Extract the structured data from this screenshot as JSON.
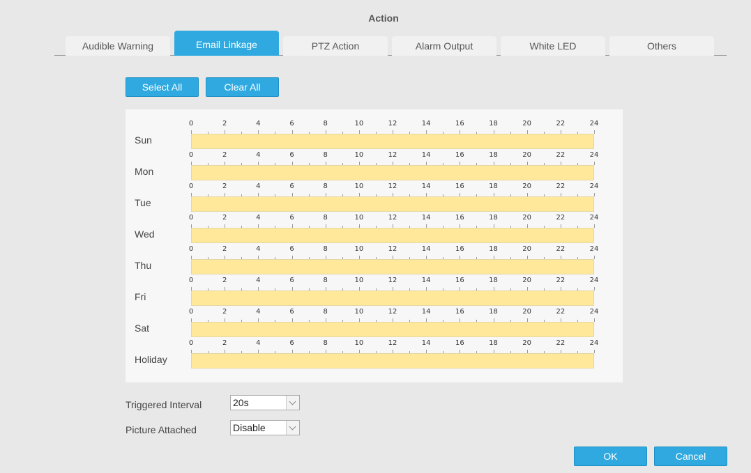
{
  "header": {
    "title": "Action"
  },
  "tabs": [
    {
      "label": "Audible Warning",
      "active": false
    },
    {
      "label": "Email Linkage",
      "active": true
    },
    {
      "label": "PTZ Action",
      "active": false
    },
    {
      "label": "Alarm Output",
      "active": false
    },
    {
      "label": "White LED",
      "active": false
    },
    {
      "label": "Others",
      "active": false
    }
  ],
  "toolbar": {
    "select_all": "Select All",
    "clear_all": "Clear All"
  },
  "schedule": {
    "days": [
      "Sun",
      "Mon",
      "Tue",
      "Wed",
      "Thu",
      "Fri",
      "Sat",
      "Holiday"
    ],
    "hour_labels": [
      "0",
      "2",
      "4",
      "6",
      "8",
      "10",
      "12",
      "14",
      "16",
      "18",
      "20",
      "22",
      "24"
    ],
    "selected_color": "#ffe89a"
  },
  "settings": {
    "triggered_interval": {
      "label": "Triggered Interval",
      "value": "20s"
    },
    "picture_attached": {
      "label": "Picture Attached",
      "value": "Disable"
    }
  },
  "footer": {
    "ok": "OK",
    "cancel": "Cancel"
  },
  "colors": {
    "accent": "#2fa9e0"
  }
}
